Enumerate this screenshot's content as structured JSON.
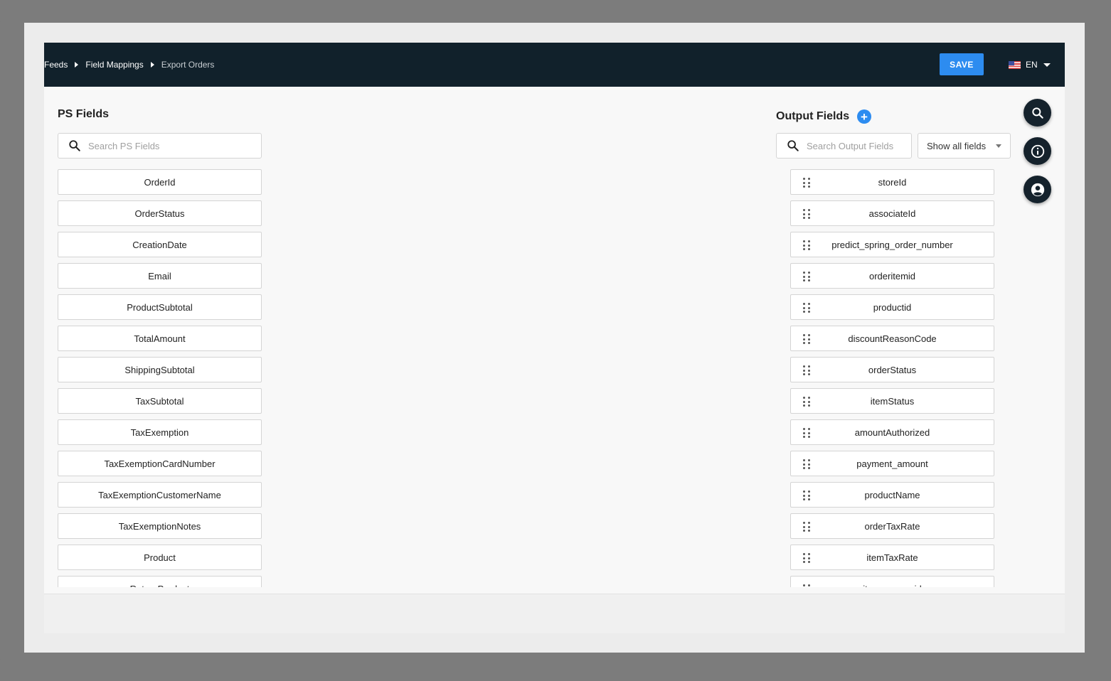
{
  "breadcrumb": {
    "items": [
      "Feeds",
      "Field Mappings",
      "Export Orders"
    ]
  },
  "header": {
    "save_label": "SAVE",
    "language": "EN"
  },
  "ps_fields": {
    "title": "PS Fields",
    "search_placeholder": "Search PS Fields",
    "items": [
      "OrderId",
      "OrderStatus",
      "CreationDate",
      "Email",
      "ProductSubtotal",
      "TotalAmount",
      "ShippingSubtotal",
      "TaxSubtotal",
      "TaxExemption",
      "TaxExemptionCardNumber",
      "TaxExemptionCustomerName",
      "TaxExemptionNotes",
      "Product",
      "ReturnProduct"
    ]
  },
  "output_fields": {
    "title": "Output Fields",
    "search_placeholder": "Search Output Fields",
    "filter_selected": "Show all fields",
    "items": [
      "storeId",
      "associateId",
      "predict_spring_order_number",
      "orderitemid",
      "productid",
      "discountReasonCode",
      "orderStatus",
      "itemStatus",
      "amountAuthorized",
      "payment_amount",
      "productName",
      "orderTaxRate",
      "itemTaxRate",
      "item_group_id"
    ]
  },
  "side_actions": [
    "search-icon",
    "info-icon",
    "account-icon"
  ],
  "colors": {
    "topbar": "#11212b",
    "accent": "#2d8cf0",
    "fab": "#15222c"
  }
}
